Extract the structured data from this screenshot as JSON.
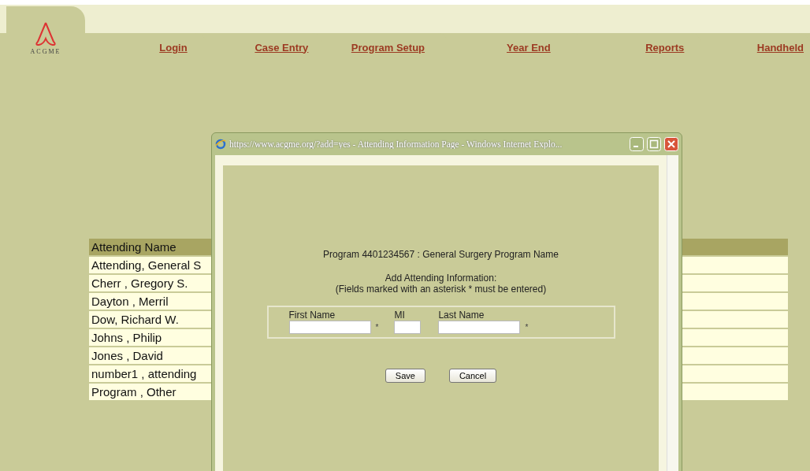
{
  "logo": {
    "text": "ACGME"
  },
  "nav": [
    {
      "label": "Login"
    },
    {
      "label": "Case Entry"
    },
    {
      "label": "Program Setup"
    },
    {
      "label": "Year End"
    },
    {
      "label": "Reports"
    },
    {
      "label": "Handheld"
    }
  ],
  "table": {
    "columns": [
      "Attending Name"
    ],
    "rows": [
      "Attending, General S",
      "Cherr , Gregory S.",
      "Dayton , Merril",
      "Dow, Richard W.",
      "Johns , Philip",
      "Jones , David",
      "number1 , attending",
      "Program , Other"
    ]
  },
  "popup": {
    "title": "https://www.acgme.org/?add=yes - Attending Information Page - Windows Internet Explo...",
    "program": "Program 4401234567 : General Surgery Program Name",
    "heading": "Add Attending Information:",
    "note": "(Fields marked with an asterisk * must be entered)",
    "fields": [
      {
        "label": "First Name",
        "required_mark": "*",
        "kind": "wide"
      },
      {
        "label": "MI",
        "kind": "narrow"
      },
      {
        "label": "Last Name",
        "required_mark": "*",
        "kind": "wide"
      }
    ],
    "buttons": [
      "Save",
      "Cancel"
    ]
  }
}
